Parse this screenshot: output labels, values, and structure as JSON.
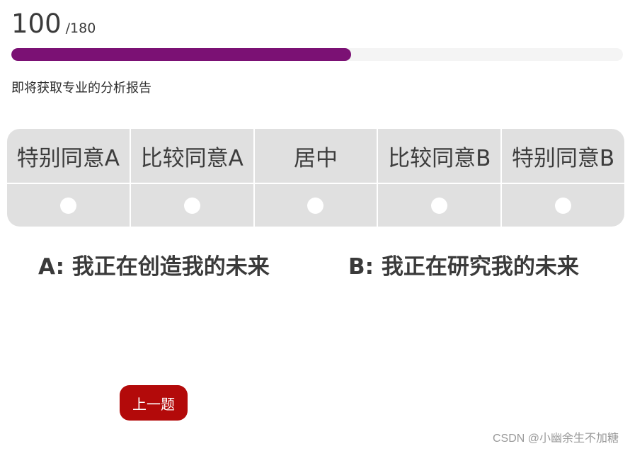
{
  "progress": {
    "current": "100",
    "total": "/180",
    "fraction": 0.5556,
    "fill_color": "#7b1174",
    "hint": "即将获取专业的分析报告"
  },
  "scale": {
    "options": [
      {
        "label": "特别同意A"
      },
      {
        "label": "比较同意A"
      },
      {
        "label": "居中"
      },
      {
        "label": "比较同意B"
      },
      {
        "label": "特别同意B"
      }
    ]
  },
  "question": {
    "option_a": "A: 我正在创造我的未来",
    "option_b": "B: 我正在研究我的未来"
  },
  "nav": {
    "prev_label": "上一题",
    "button_color": "#b30a0a"
  },
  "watermark": "CSDN @小幽余生不加糖"
}
